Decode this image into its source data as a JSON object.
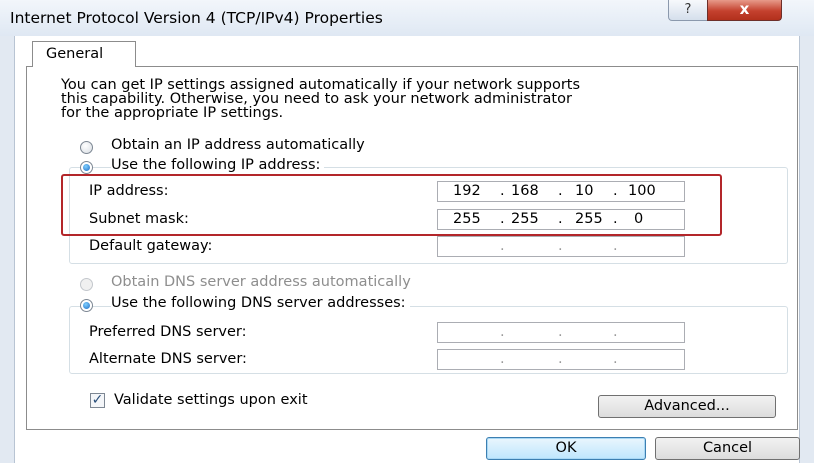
{
  "window": {
    "title": "Internet Protocol Version 4 (TCP/IPv4) Properties",
    "help_glyph": "?",
    "close_glyph": "x"
  },
  "tabs": [
    {
      "label": "General"
    }
  ],
  "description": [
    "You can get IP settings assigned automatically if your network supports",
    "this capability. Otherwise, you need to ask your network administrator",
    "for the appropriate IP settings."
  ],
  "ip_mode": {
    "auto_label": "Obtain an IP address automatically",
    "manual_label": "Use the following IP address:",
    "selected": "manual"
  },
  "ip_fields": {
    "ip_address": {
      "label": "IP address:",
      "octets": [
        "192",
        "168",
        "10",
        "100"
      ]
    },
    "subnet_mask": {
      "label": "Subnet mask:",
      "octets": [
        "255",
        "255",
        "255",
        "0"
      ]
    },
    "default_gateway": {
      "label": "Default gateway:",
      "octets": [
        "",
        "",
        "",
        ""
      ]
    }
  },
  "dns_mode": {
    "auto_label": "Obtain DNS server address automatically",
    "manual_label": "Use the following DNS server addresses:",
    "selected": "manual"
  },
  "dns_fields": {
    "preferred": {
      "label": "Preferred DNS server:",
      "octets": [
        "",
        "",
        "",
        ""
      ]
    },
    "alternate": {
      "label": "Alternate DNS server:",
      "octets": [
        "",
        "",
        "",
        ""
      ]
    }
  },
  "validate": {
    "label": "Validate settings upon exit",
    "checked": true,
    "check_glyph": "✓"
  },
  "buttons": {
    "advanced": "Advanced...",
    "ok": "OK",
    "cancel": "Cancel"
  },
  "dot_glyph": ".",
  "colors": {
    "highlight_border": "#b3262a"
  }
}
